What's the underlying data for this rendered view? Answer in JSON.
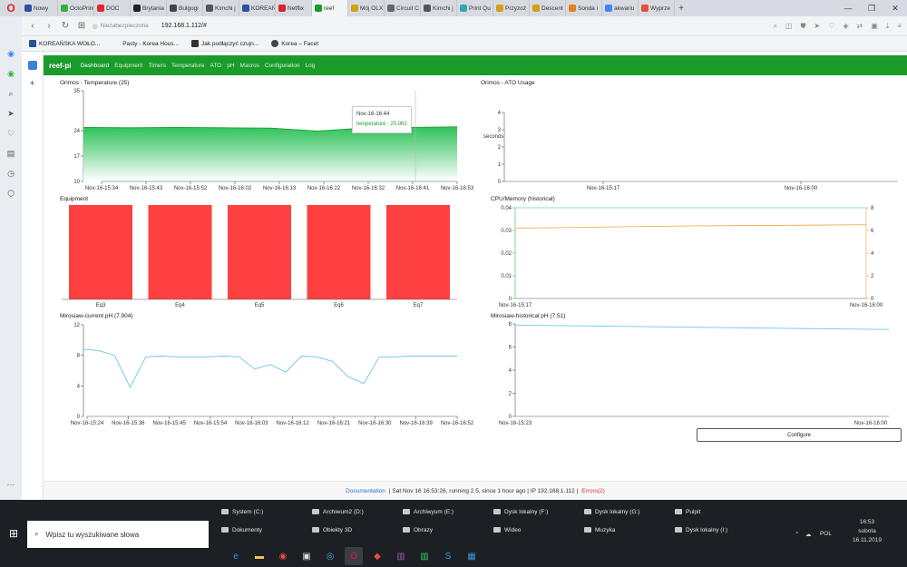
{
  "browser": {
    "tabs": [
      {
        "label": "Nowy",
        "color": "#2b4ea0"
      },
      {
        "label": "OctoPrint",
        "color": "#3cae3c"
      },
      {
        "label": "DOC",
        "color": "#e32a2a"
      },
      {
        "label": "Brytania",
        "color": "#222222"
      },
      {
        "label": "Bulgogi",
        "color": "#444444"
      },
      {
        "label": "Kimchi j",
        "color": "#555555"
      },
      {
        "label": "KOREAŃ",
        "color": "#2b4ea0"
      },
      {
        "label": "Netflix",
        "color": "#d8232a"
      },
      {
        "label": "reef",
        "color": "#1a9b2a"
      },
      {
        "label": "Mój OLX",
        "color": "#d4a017"
      },
      {
        "label": "Circuit C",
        "color": "#666666"
      },
      {
        "label": "Kimchi j",
        "color": "#555555"
      },
      {
        "label": "Print Qu",
        "color": "#2fa8b5"
      },
      {
        "label": "Przyzoż",
        "color": "#d4a017"
      },
      {
        "label": "Descent",
        "color": "#d4a017"
      },
      {
        "label": "Sonda i",
        "color": "#e67e22"
      },
      {
        "label": "akwariu",
        "color": "#4285f4"
      },
      {
        "label": "Wyprze",
        "color": "#e74c3c"
      }
    ],
    "security_label": "Niezabezpieczona",
    "url": "192.168.1.112/#",
    "bookmarks": [
      "KOREAŃSKA WOŁO...",
      "Pasty - Korea Hous...",
      "Jak podłączyć czujn...",
      "Korea – Facet"
    ]
  },
  "app": {
    "brand": "reef-pi",
    "nav": [
      "Dashboard",
      "Equipment",
      "Timers",
      "Temperature",
      "ATO",
      "pH",
      "Macros",
      "Configuration",
      "Log"
    ],
    "active_nav": "Dashboard"
  },
  "panels": {
    "temperature": {
      "title": "Orimos - Temperature (25)"
    },
    "ato": {
      "title": "Orimos - ATO Usage",
      "ylabel": "seconds"
    },
    "equipment": {
      "title": "Equipment"
    },
    "cpu": {
      "title": "CPU/Memory (historical)"
    },
    "ph_current": {
      "title": "Mirosiaw-current pH (7.904)"
    },
    "ph_historical": {
      "title": "Mirosiaw-historical pH (7.51)"
    }
  },
  "tooltip": {
    "time": "Nov-16-16:44",
    "value": "temperature : 25.062"
  },
  "configure_label": "Configure",
  "footer": {
    "doc": "Documentation",
    "status": "| Sat Nov 16 16:53:26, running 2.5, since 1 hour ago | IP 192.168.1.112 |",
    "errors": "Errors(2)"
  },
  "taskbar": {
    "search_placeholder": "Wpisz tu wyszukiwane słowa",
    "items": [
      "System (C:)",
      "Archiwum2 (D:)",
      "Archiwyum (E:)",
      "Dysk lokalny (F:)",
      "Dysk lokalny (G:)",
      "Pulpit",
      "Dokumenty",
      "Obiekty 3D",
      "Obrazy",
      "Wideo",
      "Muzyka",
      "Dysk lokalny (I:)"
    ],
    "lang": "POL",
    "time": "16:53",
    "day": "sobota",
    "date": "16.11.2019"
  },
  "colors": {
    "green": "#1a9b2a",
    "red": "#ff4040",
    "line_blue": "#6cc6e8",
    "orange": "#f0a23a"
  },
  "chart_data": [
    {
      "type": "area",
      "title": "Orimos - Temperature (25)",
      "x": [
        "Nov-16-15:34",
        "Nov-16-15:43",
        "Nov-16-15:52",
        "Nov-16-16:02",
        "Nov-16-16:13",
        "Nov-16-16:22",
        "Nov-16-16:32",
        "Nov-16-16:41",
        "Nov-16-16:53"
      ],
      "series": [
        {
          "values": [
            24.9,
            24.8,
            24.9,
            24.8,
            24.7,
            23.9,
            24.7,
            24.9,
            25.06
          ]
        }
      ],
      "ylim": [
        10,
        35
      ],
      "yticks": [
        10,
        17,
        24,
        35
      ]
    },
    {
      "type": "line",
      "title": "Orimos - ATO Usage",
      "x": [
        "Nov-16-15:17",
        "Nov-16-16:00"
      ],
      "ylabel": "seconds",
      "ylim": [
        0,
        4
      ],
      "yticks": [
        0,
        1,
        2,
        3,
        4
      ],
      "series": []
    },
    {
      "type": "bar",
      "title": "Equipment",
      "categories": [
        "Eq3",
        "Eq4",
        "Eq5",
        "Eq6",
        "Eq7"
      ],
      "values": [
        1,
        1,
        1,
        1,
        1
      ]
    },
    {
      "type": "line",
      "title": "CPU/Memory (historical)",
      "x": [
        "Nov-16-15:17",
        "Nov-16-16:00"
      ],
      "ylim": [
        0,
        0.04
      ],
      "yticks": [
        0,
        0.01,
        0.02,
        0.03,
        0.04
      ],
      "y2lim": [
        0,
        8
      ],
      "y2ticks": [
        0,
        2,
        4,
        6,
        8
      ],
      "series": [
        {
          "values": [
            6.2,
            6.4,
            6.5
          ]
        }
      ]
    },
    {
      "type": "line",
      "title": "Mirosiaw-current pH (7.904)",
      "x": [
        "Nov-16-15:24",
        "Nov-16-15:36",
        "Nov-16-15:45",
        "Nov-16-15:54",
        "Nov-16-16:03",
        "Nov-16-16:12",
        "Nov-16-16:21",
        "Nov-16-16:30",
        "Nov-16-16:39",
        "Nov-16-16:52"
      ],
      "ylim": [
        0,
        12
      ],
      "yticks": [
        0,
        4,
        8,
        12
      ],
      "series": [
        {
          "values": [
            8.8,
            8.6,
            8.0,
            3.8,
            7.8,
            7.9,
            7.8,
            7.8,
            7.8,
            7.9,
            7.8,
            6.2,
            6.8,
            5.8,
            7.9,
            7.8,
            7.2,
            5.2,
            4.3,
            7.8,
            7.8,
            7.9,
            7.9,
            7.9,
            7.9
          ]
        }
      ]
    },
    {
      "type": "line",
      "title": "Mirosiaw-historical pH (7.51)",
      "x": [
        "Nov-16-15:23",
        "Nov-16-16:00"
      ],
      "ylim": [
        0,
        8
      ],
      "yticks": [
        0,
        2,
        4,
        6,
        8
      ],
      "series": [
        {
          "values": [
            7.9,
            7.8,
            7.7,
            7.6,
            7.51
          ]
        }
      ]
    }
  ]
}
